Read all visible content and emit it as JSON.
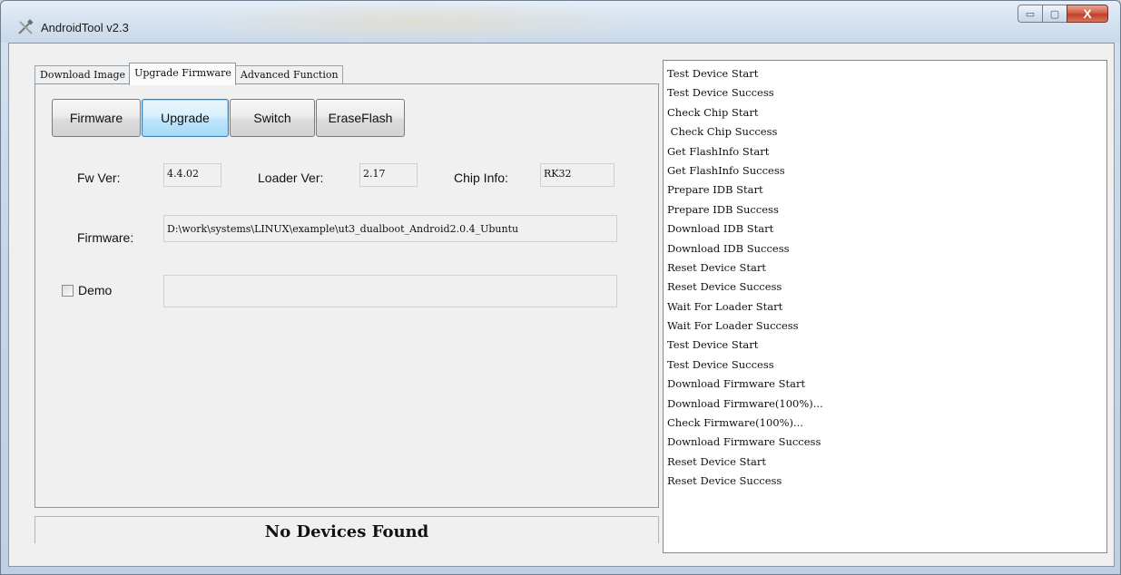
{
  "window": {
    "title": "AndroidTool v2.3",
    "icon": "tools-icon",
    "controls": {
      "minimize": "▭",
      "maximize": "▢",
      "close": "X"
    }
  },
  "tabs": [
    {
      "label": "Download Image",
      "active": false
    },
    {
      "label": "Upgrade Firmware",
      "active": true
    },
    {
      "label": "Advanced Function",
      "active": false
    }
  ],
  "toolbar": {
    "firmware_label": "Firmware",
    "upgrade_label": "Upgrade",
    "switch_label": "Switch",
    "eraseflash_label": "EraseFlash"
  },
  "info": {
    "fw_ver_label": "Fw Ver:",
    "fw_ver_value": "4.4.02",
    "loader_ver_label": "Loader Ver:",
    "loader_ver_value": "2.17",
    "chip_info_label": "Chip Info:",
    "chip_info_value": "RK32",
    "firmware_label": "Firmware:",
    "firmware_path": "D:\\work\\systems\\LINUX\\example\\ut3_dualboot_Android2.0.4_Ubuntu",
    "demo_label": "Demo",
    "demo_checked": false,
    "demo_value": ""
  },
  "status": {
    "text": "No Devices Found"
  },
  "log": [
    "Test Device Start",
    "Test Device Success",
    "Check Chip Start",
    " Check Chip Success",
    "Get FlashInfo Start",
    "Get FlashInfo Success",
    "Prepare IDB Start",
    "Prepare IDB Success",
    "Download IDB Start",
    "Download IDB Success",
    "Reset Device Start",
    "Reset Device Success",
    "Wait For Loader Start",
    "Wait For Loader Success",
    "Test Device Start",
    "Test Device Success",
    "Download Firmware Start",
    "Download Firmware(100%)...",
    "Check Firmware(100%)...",
    "Download Firmware Success",
    "Reset Device Start",
    "Reset Device Success"
  ]
}
